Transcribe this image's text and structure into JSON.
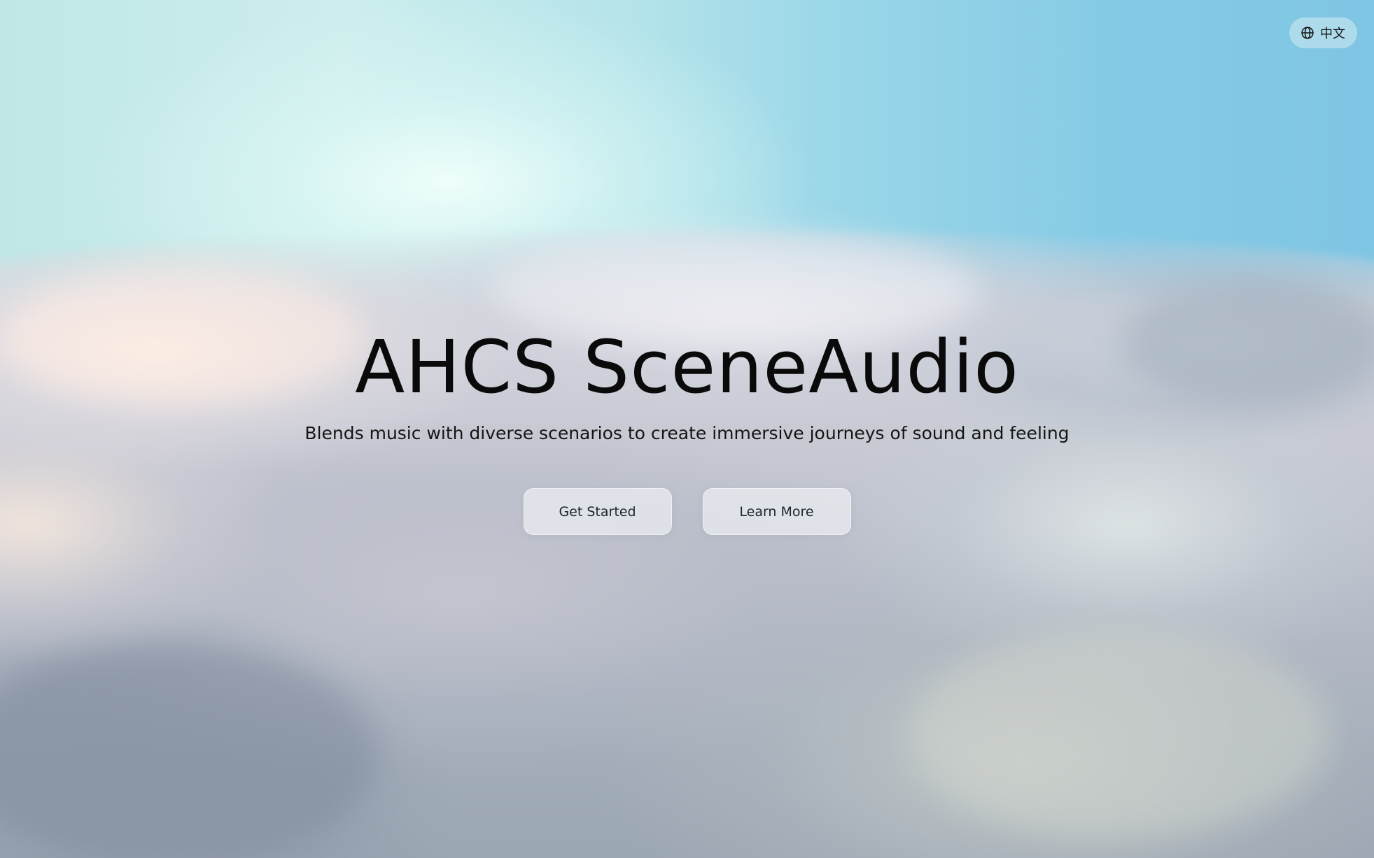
{
  "header": {
    "language_label": "中文",
    "language_icon": "globe-icon"
  },
  "hero": {
    "title": "AHCS SceneAudio",
    "subtitle": "Blends music with diverse scenarios to create immersive journeys of sound and feeling"
  },
  "actions": {
    "get_started_label": "Get Started",
    "learn_more_label": "Learn More"
  },
  "colors": {
    "sky_light": "#e4fbf6",
    "sky_blue": "#7fc6e4",
    "title_text": "#0a0a0a",
    "button_bg": "#eceef3"
  }
}
